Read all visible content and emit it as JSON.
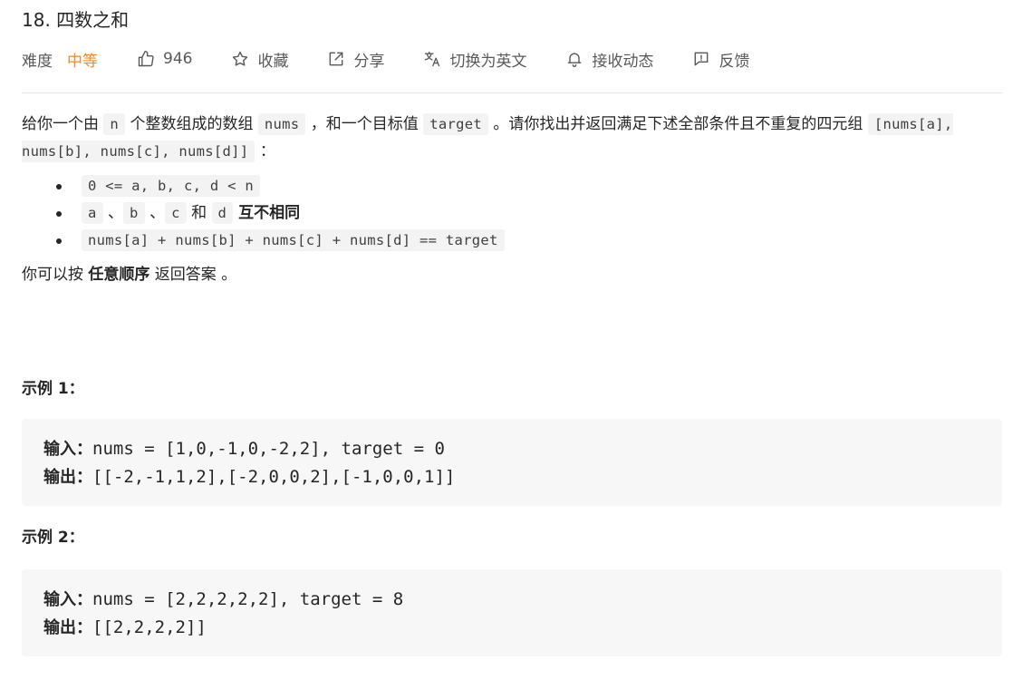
{
  "problem": {
    "title": "18. 四数之和",
    "difficulty_label": "难度",
    "difficulty_value": "中等",
    "likes": "946",
    "favorite_label": "收藏",
    "share_label": "分享",
    "switch_lang_label": "切换为英文",
    "notify_label": "接收动态",
    "feedback_label": "反馈"
  },
  "description": {
    "p1_a": "给你一个由 ",
    "p1_code_n": "n",
    "p1_b": " 个整数组成的数组 ",
    "p1_code_nums": "nums",
    "p1_c": " ，和一个目标值 ",
    "p1_code_target": "target",
    "p1_d": " 。请你找出并返回满足下述全部条件且不重复的四元组 ",
    "p1_code_quad": "[nums[a], nums[b], nums[c], nums[d]]",
    "p1_e": " ：",
    "cond1_code": "0 <= a, b, c, d < n",
    "cond2_a": "a",
    "cond2_sep1": " 、",
    "cond2_b": "b",
    "cond2_sep2": " 、",
    "cond2_c": "c",
    "cond2_and": " 和 ",
    "cond2_d": "d",
    "cond2_bold": " 互不相同",
    "cond3_code": "nums[a] + nums[b] + nums[c] + nums[d] == target",
    "p2_a": "你可以按 ",
    "p2_bold": "任意顺序",
    "p2_b": " 返回答案 。"
  },
  "examples": [
    {
      "heading": "示例 1：",
      "input_label": "输入：",
      "input_value": "nums = [1,0,-1,0,-2,2], target = 0",
      "output_label": "输出：",
      "output_value": "[[-2,-1,1,2],[-2,0,0,2],[-1,0,0,1]]"
    },
    {
      "heading": "示例 2：",
      "input_label": "输入：",
      "input_value": "nums = [2,2,2,2,2], target = 8",
      "output_label": "输出：",
      "output_value": "[[2,2,2,2]]"
    }
  ],
  "colors": {
    "difficulty_medium": "#ef8b2c",
    "code_bg": "#f3f3f3",
    "example_bg": "#f7f7f8"
  },
  "icons": [
    "thumbs-up-icon",
    "star-icon",
    "share-icon",
    "translate-icon",
    "bell-icon",
    "feedback-icon"
  ]
}
